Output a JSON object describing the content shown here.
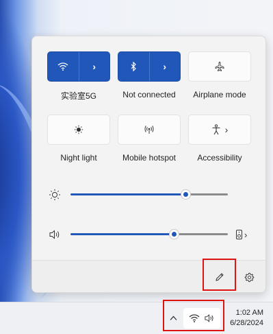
{
  "quick_settings": {
    "tiles": [
      {
        "label": "实验室5G",
        "icon": "wifi-icon",
        "state": "on"
      },
      {
        "label": "Not connected",
        "icon": "bluetooth-icon",
        "state": "on"
      },
      {
        "label": "Airplane mode",
        "icon": "airplane-icon",
        "state": "off"
      },
      {
        "label": "Night light",
        "icon": "night-light-icon",
        "state": "off"
      },
      {
        "label": "Mobile hotspot",
        "icon": "hotspot-icon",
        "state": "off"
      },
      {
        "label": "Accessibility",
        "icon": "accessibility-icon",
        "state": "off"
      }
    ],
    "brightness": {
      "icon": "brightness-icon",
      "value_fraction": 0.73
    },
    "volume": {
      "icon": "speaker-icon",
      "value_fraction": 0.62
    },
    "footer": {
      "edit_icon": "pencil-icon",
      "settings_icon": "gear-icon"
    }
  },
  "taskbar": {
    "overflow_icon": "chevron-up-icon",
    "tray_icons": [
      "wifi-icon",
      "speaker-icon"
    ],
    "time": "1:02 AM",
    "date": "6/28/2024"
  },
  "colors": {
    "accent": "#2157b8",
    "highlight": "#e01212"
  }
}
